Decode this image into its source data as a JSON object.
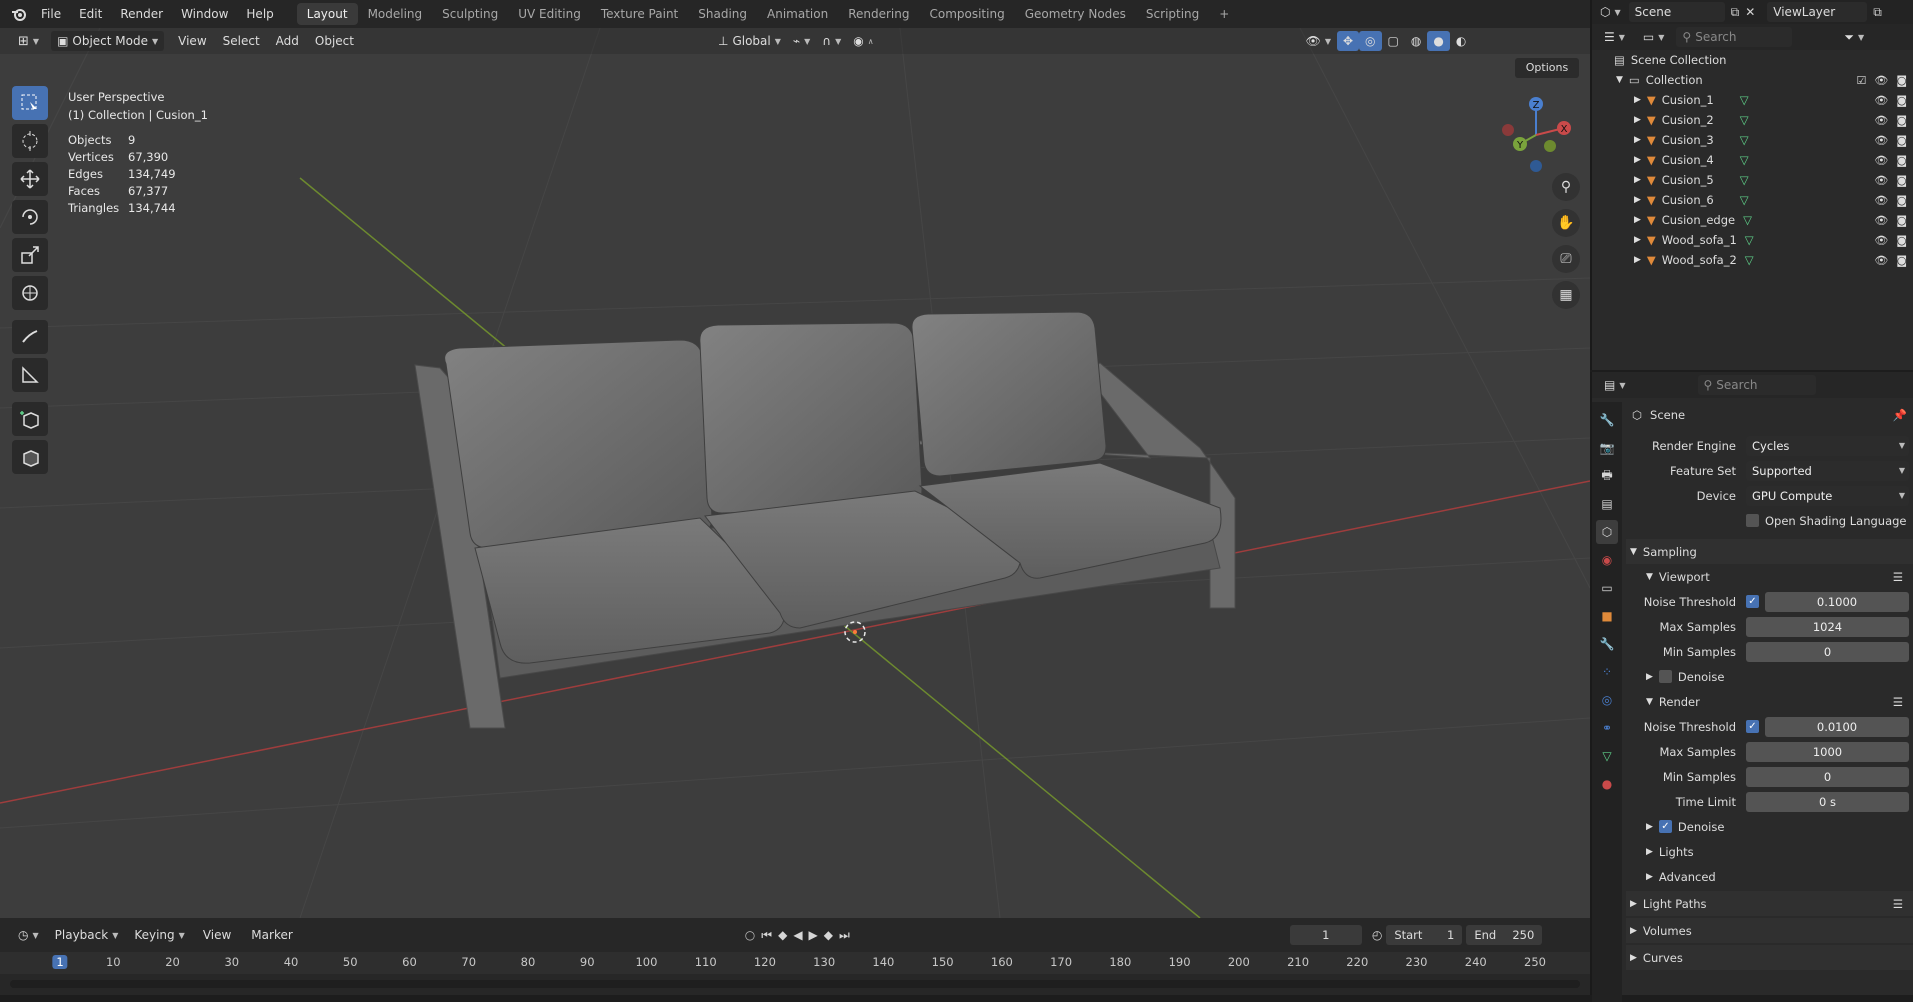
{
  "menu": {
    "file": "File",
    "edit": "Edit",
    "render": "Render",
    "window": "Window",
    "help": "Help"
  },
  "workspaces": [
    "Layout",
    "Modeling",
    "Sculpting",
    "UV Editing",
    "Texture Paint",
    "Shading",
    "Animation",
    "Rendering",
    "Compositing",
    "Geometry Nodes",
    "Scripting"
  ],
  "active_workspace": "Layout",
  "scene_name": "Scene",
  "view_layer": "ViewLayer",
  "viewport_header": {
    "mode": "Object Mode",
    "view": "View",
    "select": "Select",
    "add": "Add",
    "object": "Object",
    "orientation": "Global",
    "options": "Options"
  },
  "viewport_info": {
    "perspective": "User Perspective",
    "context": "(1) Collection | Cusion_1"
  },
  "stats": [
    {
      "k": "Objects",
      "v": "9"
    },
    {
      "k": "Vertices",
      "v": "67,390"
    },
    {
      "k": "Edges",
      "v": "134,749"
    },
    {
      "k": "Faces",
      "v": "67,377"
    },
    {
      "k": "Triangles",
      "v": "134,744"
    }
  ],
  "gizmo": {
    "x": "X",
    "y": "Y",
    "z": "Z"
  },
  "outliner": {
    "search_placeholder": "Search",
    "scene_collection": "Scene Collection",
    "collection": "Collection",
    "objects": [
      "Cusion_1",
      "Cusion_2",
      "Cusion_3",
      "Cusion_4",
      "Cusion_5",
      "Cusion_6",
      "Cusion_edge",
      "Wood_sofa_1",
      "Wood_sofa_2"
    ]
  },
  "properties": {
    "search_placeholder": "Search",
    "context": "Scene",
    "render_engine_label": "Render Engine",
    "render_engine": "Cycles",
    "feature_set_label": "Feature Set",
    "feature_set": "Supported",
    "device_label": "Device",
    "device": "GPU Compute",
    "osl": "Open Shading Language",
    "sampling": "Sampling",
    "viewport": "Viewport",
    "render": "Render",
    "noise_threshold_label": "Noise Threshold",
    "max_samples_label": "Max Samples",
    "min_samples_label": "Min Samples",
    "time_limit_label": "Time Limit",
    "denoise": "Denoise",
    "vp_noise_threshold": "0.1000",
    "vp_max_samples": "1024",
    "vp_min_samples": "0",
    "r_noise_threshold": "0.0100",
    "r_max_samples": "1000",
    "r_min_samples": "0",
    "r_time_limit": "0 s",
    "lights": "Lights",
    "advanced": "Advanced",
    "light_paths": "Light Paths",
    "volumes": "Volumes",
    "curves": "Curves"
  },
  "timeline": {
    "playback": "Playback",
    "keying": "Keying",
    "view": "View",
    "marker": "Marker",
    "current_frame": "1",
    "start_label": "Start",
    "start": "1",
    "end_label": "End",
    "end": "250",
    "ruler": [
      "1",
      "10",
      "20",
      "30",
      "40",
      "50",
      "60",
      "70",
      "80",
      "90",
      "100",
      "110",
      "120",
      "130",
      "140",
      "150",
      "160",
      "170",
      "180",
      "190",
      "200",
      "210",
      "220",
      "230",
      "240",
      "250"
    ]
  },
  "colors": {
    "accent": "#4772b3",
    "x_axis": "#c94a4a",
    "y_axis": "#7aa33c",
    "z_axis": "#4a7fcf",
    "object_icon": "#e08a3a",
    "mesh_icon": "#5fd18a"
  }
}
